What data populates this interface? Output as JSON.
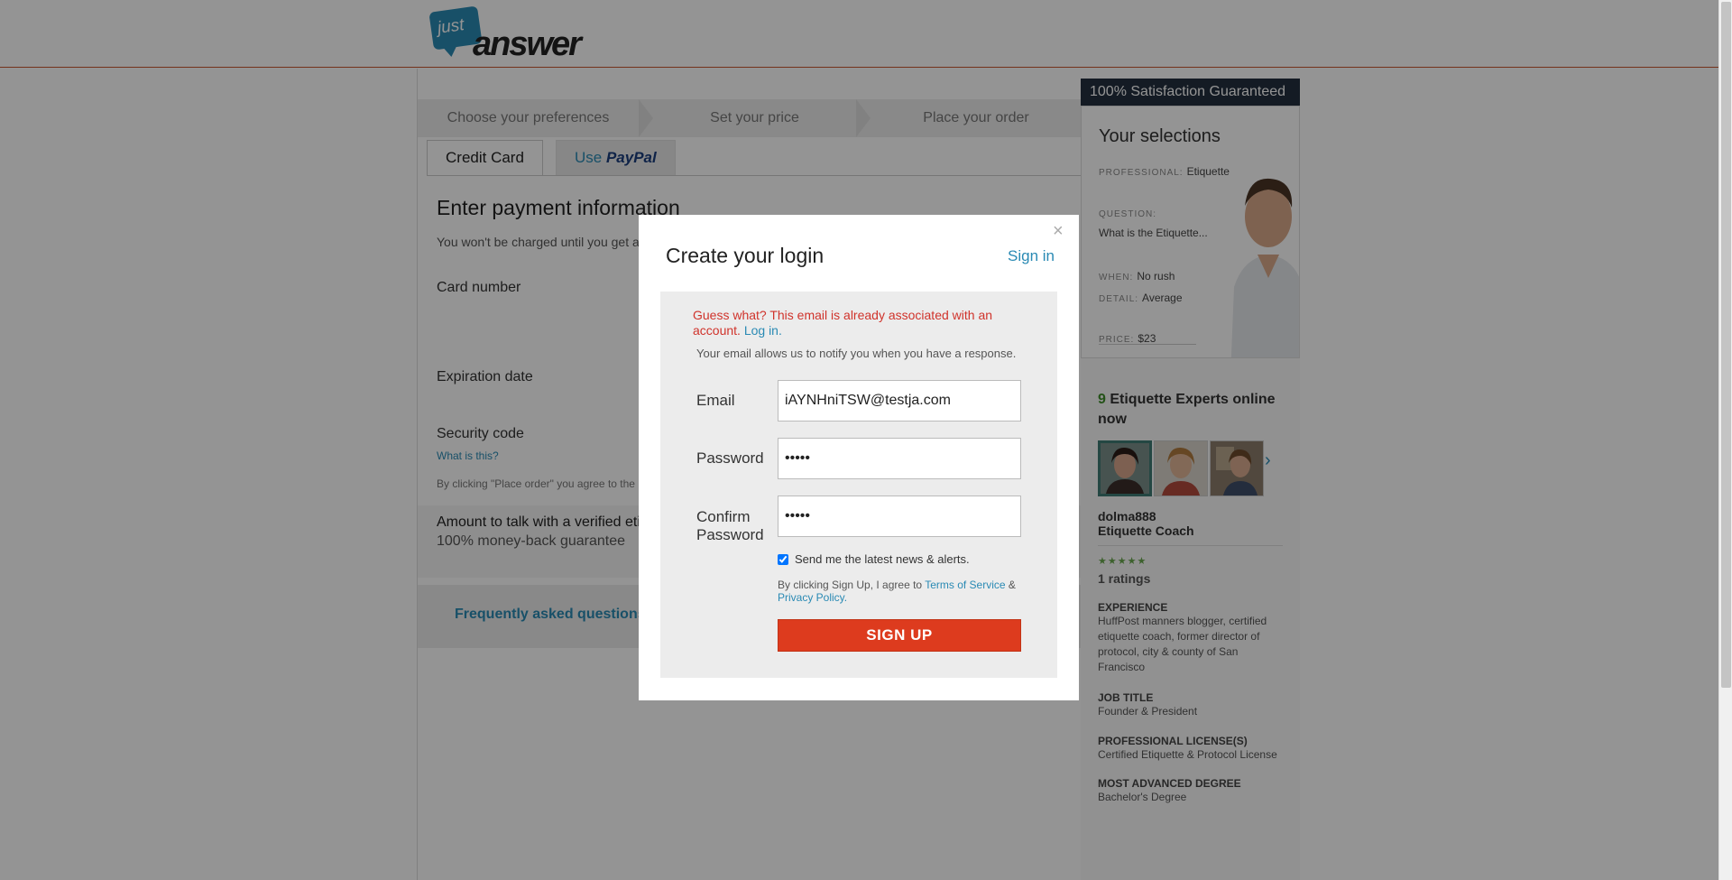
{
  "logo": {
    "just": "just",
    "answer": "answer"
  },
  "steps": [
    "Choose your preferences",
    "Set your price",
    "Place your order"
  ],
  "tabs": {
    "credit_card": "Credit Card",
    "paypal_use": "Use",
    "paypal_brand": "PayPal"
  },
  "payment": {
    "title": "Enter payment information",
    "subtitle": "You won't be charged until you get a",
    "card_number": "Card number",
    "expiration": "Expiration date",
    "security": "Security code",
    "what_is_this": "What is this?",
    "agree": "By clicking \"Place order\" you agree to the",
    "amount_line1": "Amount to talk with a verified etiq",
    "amount_line2": "100% money-back guarantee",
    "faq": "Frequently asked questions"
  },
  "sidebar": {
    "guarantee": "100% Satisfaction Guaranteed",
    "selections_title": "Your selections",
    "professional_key": "PROFESSIONAL:",
    "professional_val": "Etiquette",
    "question_key": "QUESTION:",
    "question_val": "What is the Etiquette...",
    "when_key": "WHEN:",
    "when_val": "No rush",
    "detail_key": "DETAIL:",
    "detail_val": "Average",
    "price_key": "PRICE:",
    "price_val": "$23",
    "experts_count": "9",
    "experts_title": "Etiquette Experts online now",
    "expert_username": "dolma888",
    "expert_role": "Etiquette Coach",
    "stars": "★★★★★",
    "ratings": "1 ratings",
    "experience_key": "EXPERIENCE",
    "experience_val": "HuffPost manners blogger, certified etiquette coach, former director of protocol, city & county of San Francisco",
    "job_key": "JOB TITLE",
    "job_val": "Founder & President",
    "license_key": "PROFESSIONAL LICENSE(S)",
    "license_val": "Certified Etiquette & Protocol License",
    "degree_key": "MOST ADVANCED DEGREE",
    "degree_val": "Bachelor's Degree"
  },
  "modal": {
    "close": "×",
    "title": "Create your login",
    "signin": "Sign in",
    "error": "Guess what? This email is already associated with an account.",
    "error_login": "Log in.",
    "notice": "Your email allows us to notify you when you have a response.",
    "email_label": "Email",
    "email_value": "iAYNHniTSW@testja.com",
    "password_label": "Password",
    "password_value": "•••••",
    "confirm_label": "Confirm Password",
    "confirm_value": "•••••",
    "news_label": "Send me the latest news & alerts.",
    "news_checked": true,
    "terms_prefix": "By clicking Sign Up, I agree to",
    "terms_link": "Terms of Service",
    "terms_amp": "&",
    "privacy_link": "Privacy Policy.",
    "signup": "SIGN UP"
  },
  "colors": {
    "accent": "#2a8ab4",
    "signup": "#dd3b1e",
    "error": "#d0332b",
    "expert_count": "#3e8e2a"
  }
}
